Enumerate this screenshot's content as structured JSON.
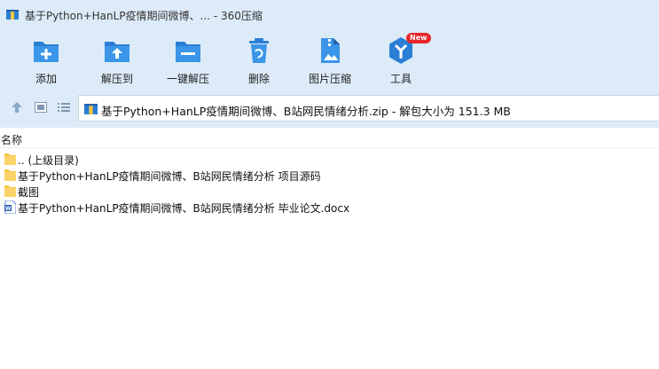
{
  "window": {
    "title": "基于Python+HanLP疫情期间微博、... - 360压缩"
  },
  "toolbar": {
    "items": [
      {
        "label": "添加",
        "icon": "add-icon"
      },
      {
        "label": "解压到",
        "icon": "extract-to-icon"
      },
      {
        "label": "一键解压",
        "icon": "one-click-extract-icon"
      },
      {
        "label": "删除",
        "icon": "delete-icon"
      },
      {
        "label": "图片压缩",
        "icon": "image-compress-icon"
      },
      {
        "label": "工具",
        "icon": "tools-icon",
        "badge": "New"
      }
    ]
  },
  "address": {
    "text": "基于Python+HanLP疫情期间微博、B站网民情绪分析.zip - 解包大小为 151.3 MB"
  },
  "list": {
    "column_name": "名称",
    "items": [
      {
        "name": ".. (上级目录)",
        "type": "folder"
      },
      {
        "name": "基于Python+HanLP疫情期间微博、B站网民情绪分析 项目源码",
        "type": "folder"
      },
      {
        "name": "截图",
        "type": "folder"
      },
      {
        "name": "基于Python+HanLP疫情期间微博、B站网民情绪分析 毕业论文.docx",
        "type": "docx"
      }
    ]
  },
  "colors": {
    "chrome": "#ddebf8",
    "accent": "#2a7fd4",
    "folder": "#f5c542",
    "badge": "#e8262c"
  }
}
